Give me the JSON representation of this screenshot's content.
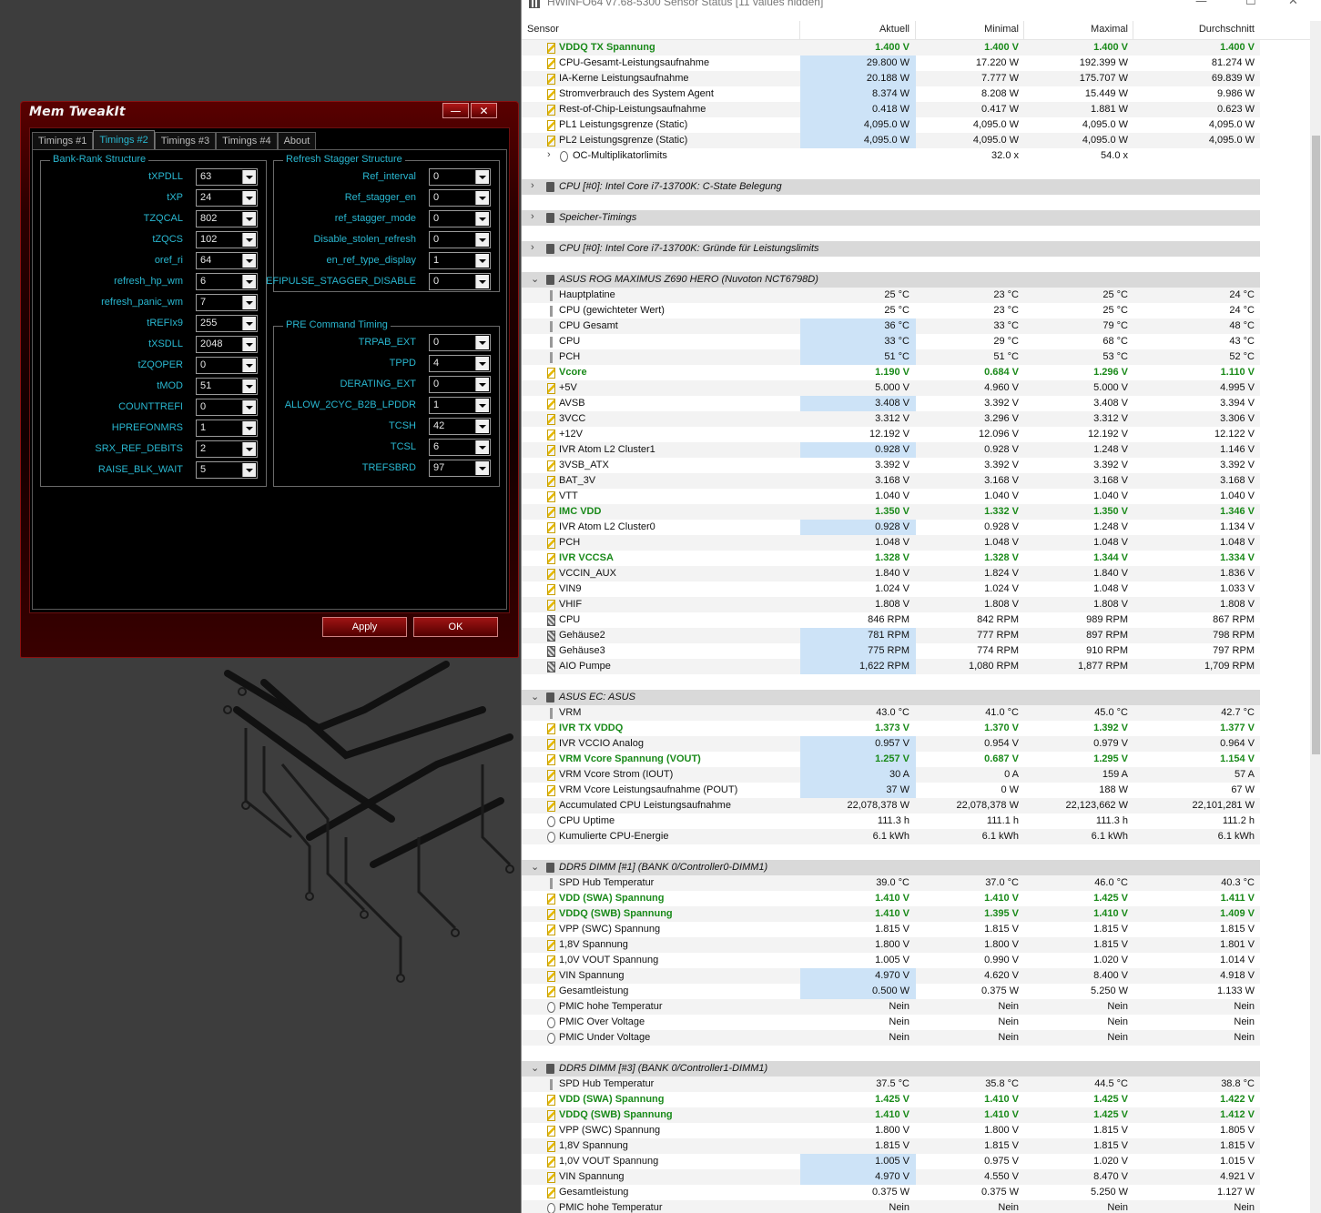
{
  "memtweakit": {
    "title": "Mem TweakIt",
    "min_glyph": "—",
    "close_glyph": "✕",
    "tabs": [
      "Timings #1",
      "Timings #2",
      "Timings #3",
      "Timings #4",
      "About"
    ],
    "active_tab": "Timings #2",
    "bank_rank": {
      "title": "Bank-Rank Structure",
      "rows": [
        {
          "label": "tXPDLL",
          "value": "63"
        },
        {
          "label": "tXP",
          "value": "24"
        },
        {
          "label": "TZQCAL",
          "value": "802"
        },
        {
          "label": "tZQCS",
          "value": "102"
        },
        {
          "label": "oref_ri",
          "value": "64"
        },
        {
          "label": "refresh_hp_wm",
          "value": "6"
        },
        {
          "label": "refresh_panic_wm",
          "value": "7"
        },
        {
          "label": "tREFIx9",
          "value": "255"
        },
        {
          "label": "tXSDLL",
          "value": "2048"
        },
        {
          "label": "tZQOPER",
          "value": "0"
        },
        {
          "label": "tMOD",
          "value": "51"
        },
        {
          "label": "COUNTTREFI",
          "value": "0"
        },
        {
          "label": "HPREFONMRS",
          "value": "1"
        },
        {
          "label": "SRX_REF_DEBITS",
          "value": "2"
        },
        {
          "label": "RAISE_BLK_WAIT",
          "value": "5"
        }
      ]
    },
    "refresh_stagger": {
      "title": "Refresh Stagger Structure",
      "rows": [
        {
          "label": "Ref_interval",
          "value": "0"
        },
        {
          "label": "Ref_stagger_en",
          "value": "0"
        },
        {
          "label": "ref_stagger_mode",
          "value": "0"
        },
        {
          "label": "Disable_stolen_refresh",
          "value": "0"
        },
        {
          "label": "en_ref_type_display",
          "value": "1"
        },
        {
          "label": "EFIPULSE_STAGGER_DISABLE",
          "value": "0"
        }
      ]
    },
    "pre_command": {
      "title": "PRE Command Timing",
      "rows": [
        {
          "label": "TRPAB_EXT",
          "value": "0"
        },
        {
          "label": "TPPD",
          "value": "4"
        },
        {
          "label": "DERATING_EXT",
          "value": "0"
        },
        {
          "label": "ALLOW_2CYC_B2B_LPDDR",
          "value": "1"
        },
        {
          "label": "TCSH",
          "value": "42"
        },
        {
          "label": "TCSL",
          "value": "6"
        },
        {
          "label": "TREFSBRD",
          "value": "97"
        }
      ]
    },
    "apply_label": "Apply",
    "ok_label": "OK"
  },
  "hwinfo": {
    "title": "HWiNFO64 v7.68-5300 Sensor Status [11 values hidden]",
    "controls": {
      "min": "—",
      "max": "☐",
      "close": "✕"
    },
    "columns": [
      "Sensor",
      "Aktuell",
      "Minimal",
      "Maximal",
      "Durchschnitt"
    ],
    "colors": {
      "green": "#1a8a1a",
      "highlight": "#cde3f7",
      "section_bg": "#d9d9d9"
    },
    "rows": [
      {
        "t": "v",
        "icon": "volt",
        "name": "VDDQ TX Spannung",
        "green": true,
        "cur": "1.400 V",
        "min": "1.400 V",
        "max": "1.400 V",
        "avg": "1.400 V"
      },
      {
        "t": "v",
        "icon": "volt",
        "name": "CPU-Gesamt-Leistungsaufnahme",
        "hl": true,
        "cur": "29.800 W",
        "min": "17.220 W",
        "max": "192.399 W",
        "avg": "81.274 W"
      },
      {
        "t": "v",
        "icon": "volt",
        "name": "IA-Kerne Leistungsaufnahme",
        "hl": true,
        "cur": "20.188 W",
        "min": "7.777 W",
        "max": "175.707 W",
        "avg": "69.839 W"
      },
      {
        "t": "v",
        "icon": "volt",
        "name": "Stromverbrauch des System Agent",
        "hl": true,
        "cur": "8.374 W",
        "min": "8.208 W",
        "max": "15.449 W",
        "avg": "9.986 W"
      },
      {
        "t": "v",
        "icon": "volt",
        "name": "Rest-of-Chip-Leistungsaufnahme",
        "hl": true,
        "cur": "0.418 W",
        "min": "0.417 W",
        "max": "1.881 W",
        "avg": "0.623 W"
      },
      {
        "t": "v",
        "icon": "volt",
        "name": "PL1 Leistungsgrenze (Static)",
        "hl": true,
        "cur": "4,095.0 W",
        "min": "4,095.0 W",
        "max": "4,095.0 W",
        "avg": "4,095.0 W"
      },
      {
        "t": "v",
        "icon": "volt",
        "name": "PL2 Leistungsgrenze (Static)",
        "hl": true,
        "cur": "4,095.0 W",
        "min": "4,095.0 W",
        "max": "4,095.0 W",
        "avg": "4,095.0 W"
      },
      {
        "t": "g",
        "icon": "clk",
        "name": "OC-Multiplikatorlimits",
        "cur": "",
        "min": "32.0 x",
        "max": "54.0 x",
        "avg": ""
      },
      {
        "t": "blank"
      },
      {
        "t": "s",
        "exp": ">",
        "name": "CPU [#0]: Intel Core i7-13700K: C-State Belegung"
      },
      {
        "t": "blank"
      },
      {
        "t": "s",
        "exp": ">",
        "name": "Speicher-Timings"
      },
      {
        "t": "blank"
      },
      {
        "t": "s",
        "exp": ">",
        "name": "CPU [#0]: Intel Core i7-13700K: Gründe für Leistungslimits"
      },
      {
        "t": "blank"
      },
      {
        "t": "s",
        "exp": "v",
        "name": "ASUS ROG MAXIMUS Z690 HERO (Nuvoton NCT6798D)"
      },
      {
        "t": "v",
        "icon": "temp",
        "name": "Hauptplatine",
        "cur": "25 °C",
        "min": "23 °C",
        "max": "25 °C",
        "avg": "24 °C"
      },
      {
        "t": "v",
        "icon": "temp",
        "name": "CPU (gewichteter Wert)",
        "cur": "25 °C",
        "min": "23 °C",
        "max": "25 °C",
        "avg": "24 °C"
      },
      {
        "t": "v",
        "icon": "temp",
        "name": "CPU Gesamt",
        "hl": true,
        "cur": "36 °C",
        "min": "33 °C",
        "max": "79 °C",
        "avg": "48 °C"
      },
      {
        "t": "v",
        "icon": "temp",
        "name": "CPU",
        "hl": true,
        "cur": "33 °C",
        "min": "29 °C",
        "max": "68 °C",
        "avg": "43 °C"
      },
      {
        "t": "v",
        "icon": "temp",
        "name": "PCH",
        "hl": true,
        "cur": "51 °C",
        "min": "51 °C",
        "max": "53 °C",
        "avg": "52 °C"
      },
      {
        "t": "v",
        "icon": "volt",
        "name": "Vcore",
        "green": true,
        "cur": "1.190 V",
        "min": "0.684 V",
        "max": "1.296 V",
        "avg": "1.110 V"
      },
      {
        "t": "v",
        "icon": "volt",
        "name": "+5V",
        "cur": "5.000 V",
        "min": "4.960 V",
        "max": "5.000 V",
        "avg": "4.995 V"
      },
      {
        "t": "v",
        "icon": "volt",
        "name": "AVSB",
        "hl": true,
        "cur": "3.408 V",
        "min": "3.392 V",
        "max": "3.408 V",
        "avg": "3.394 V"
      },
      {
        "t": "v",
        "icon": "volt",
        "name": "3VCC",
        "cur": "3.312 V",
        "min": "3.296 V",
        "max": "3.312 V",
        "avg": "3.306 V"
      },
      {
        "t": "v",
        "icon": "volt",
        "name": "+12V",
        "cur": "12.192 V",
        "min": "12.096 V",
        "max": "12.192 V",
        "avg": "12.122 V"
      },
      {
        "t": "v",
        "icon": "volt",
        "name": "IVR Atom L2 Cluster1",
        "hl": true,
        "cur": "0.928 V",
        "min": "0.928 V",
        "max": "1.248 V",
        "avg": "1.146 V"
      },
      {
        "t": "v",
        "icon": "volt",
        "name": "3VSB_ATX",
        "cur": "3.392 V",
        "min": "3.392 V",
        "max": "3.392 V",
        "avg": "3.392 V"
      },
      {
        "t": "v",
        "icon": "volt",
        "name": "BAT_3V",
        "cur": "3.168 V",
        "min": "3.168 V",
        "max": "3.168 V",
        "avg": "3.168 V"
      },
      {
        "t": "v",
        "icon": "volt",
        "name": "VTT",
        "cur": "1.040 V",
        "min": "1.040 V",
        "max": "1.040 V",
        "avg": "1.040 V"
      },
      {
        "t": "v",
        "icon": "volt",
        "name": "IMC VDD",
        "green": true,
        "cur": "1.350 V",
        "min": "1.332 V",
        "max": "1.350 V",
        "avg": "1.346 V"
      },
      {
        "t": "v",
        "icon": "volt",
        "name": "IVR Atom L2 Cluster0",
        "hl": true,
        "cur": "0.928 V",
        "min": "0.928 V",
        "max": "1.248 V",
        "avg": "1.134 V"
      },
      {
        "t": "v",
        "icon": "volt",
        "name": "PCH",
        "cur": "1.048 V",
        "min": "1.048 V",
        "max": "1.048 V",
        "avg": "1.048 V"
      },
      {
        "t": "v",
        "icon": "volt",
        "name": "IVR VCCSA",
        "green": true,
        "cur": "1.328 V",
        "min": "1.328 V",
        "max": "1.344 V",
        "avg": "1.334 V"
      },
      {
        "t": "v",
        "icon": "volt",
        "name": "VCCIN_AUX",
        "cur": "1.840 V",
        "min": "1.824 V",
        "max": "1.840 V",
        "avg": "1.836 V"
      },
      {
        "t": "v",
        "icon": "volt",
        "name": "VIN9",
        "cur": "1.024 V",
        "min": "1.024 V",
        "max": "1.048 V",
        "avg": "1.033 V"
      },
      {
        "t": "v",
        "icon": "volt",
        "name": "VHIF",
        "cur": "1.808 V",
        "min": "1.808 V",
        "max": "1.808 V",
        "avg": "1.808 V"
      },
      {
        "t": "v",
        "icon": "fan",
        "name": "CPU",
        "cur": "846 RPM",
        "min": "842 RPM",
        "max": "989 RPM",
        "avg": "867 RPM"
      },
      {
        "t": "v",
        "icon": "fan",
        "name": "Gehäuse2",
        "hl": true,
        "cur": "781 RPM",
        "min": "777 RPM",
        "max": "897 RPM",
        "avg": "798 RPM"
      },
      {
        "t": "v",
        "icon": "fan",
        "name": "Gehäuse3",
        "hl": true,
        "cur": "775 RPM",
        "min": "774 RPM",
        "max": "910 RPM",
        "avg": "797 RPM"
      },
      {
        "t": "v",
        "icon": "fan",
        "name": "AIO Pumpe",
        "hl": true,
        "cur": "1,622 RPM",
        "min": "1,080 RPM",
        "max": "1,877 RPM",
        "avg": "1,709 RPM"
      },
      {
        "t": "blank"
      },
      {
        "t": "s",
        "exp": "v",
        "name": "ASUS EC: ASUS"
      },
      {
        "t": "v",
        "icon": "temp",
        "name": "VRM",
        "cur": "43.0 °C",
        "min": "41.0 °C",
        "max": "45.0 °C",
        "avg": "42.7 °C"
      },
      {
        "t": "v",
        "icon": "volt",
        "name": "IVR TX VDDQ",
        "green": true,
        "cur": "1.373 V",
        "min": "1.370 V",
        "max": "1.392 V",
        "avg": "1.377 V"
      },
      {
        "t": "v",
        "icon": "volt",
        "name": "IVR VCCIO Analog",
        "hl": true,
        "cur": "0.957 V",
        "min": "0.954 V",
        "max": "0.979 V",
        "avg": "0.964 V"
      },
      {
        "t": "v",
        "icon": "volt",
        "name": "VRM Vcore Spannung (VOUT)",
        "green": true,
        "hl": true,
        "cur": "1.257 V",
        "min": "0.687 V",
        "max": "1.295 V",
        "avg": "1.154 V"
      },
      {
        "t": "v",
        "icon": "volt",
        "name": "VRM Vcore Strom (IOUT)",
        "hl": true,
        "cur": "30 A",
        "min": "0 A",
        "max": "159 A",
        "avg": "57 A"
      },
      {
        "t": "v",
        "icon": "volt",
        "name": "VRM Vcore Leistungsaufnahme (POUT)",
        "hl": true,
        "cur": "37 W",
        "min": "0 W",
        "max": "188 W",
        "avg": "67 W"
      },
      {
        "t": "v",
        "icon": "volt",
        "name": "Accumulated CPU Leistungsaufnahme",
        "cur": "22,078,378 W",
        "min": "22,078,378 W",
        "max": "22,123,662 W",
        "avg": "22,101,281 W"
      },
      {
        "t": "v",
        "icon": "clk",
        "name": "CPU Uptime",
        "cur": "111.3 h",
        "min": "111.1 h",
        "max": "111.3 h",
        "avg": "111.2 h"
      },
      {
        "t": "v",
        "icon": "clk",
        "name": "Kumulierte CPU-Energie",
        "cur": "6.1 kWh",
        "min": "6.1 kWh",
        "max": "6.1 kWh",
        "avg": "6.1 kWh"
      },
      {
        "t": "blank"
      },
      {
        "t": "s",
        "exp": "v",
        "name": "DDR5 DIMM [#1] (BANK 0/Controller0-DIMM1)"
      },
      {
        "t": "v",
        "icon": "temp",
        "name": "SPD Hub Temperatur",
        "cur": "39.0 °C",
        "min": "37.0 °C",
        "max": "46.0 °C",
        "avg": "40.3 °C"
      },
      {
        "t": "v",
        "icon": "volt",
        "name": "VDD (SWA) Spannung",
        "green": true,
        "cur": "1.410 V",
        "min": "1.410 V",
        "max": "1.425 V",
        "avg": "1.411 V"
      },
      {
        "t": "v",
        "icon": "volt",
        "name": "VDDQ (SWB) Spannung",
        "green": true,
        "cur": "1.410 V",
        "min": "1.395 V",
        "max": "1.410 V",
        "avg": "1.409 V"
      },
      {
        "t": "v",
        "icon": "volt",
        "name": "VPP (SWC) Spannung",
        "cur": "1.815 V",
        "min": "1.815 V",
        "max": "1.815 V",
        "avg": "1.815 V"
      },
      {
        "t": "v",
        "icon": "volt",
        "name": "1,8V Spannung",
        "cur": "1.800 V",
        "min": "1.800 V",
        "max": "1.815 V",
        "avg": "1.801 V"
      },
      {
        "t": "v",
        "icon": "volt",
        "name": "1,0V VOUT Spannung",
        "cur": "1.005 V",
        "min": "0.990 V",
        "max": "1.020 V",
        "avg": "1.014 V"
      },
      {
        "t": "v",
        "icon": "volt",
        "name": "VIN Spannung",
        "hl": true,
        "cur": "4.970 V",
        "min": "4.620 V",
        "max": "8.400 V",
        "avg": "4.918 V"
      },
      {
        "t": "v",
        "icon": "volt",
        "name": "Gesamtleistung",
        "hl": true,
        "cur": "0.500 W",
        "min": "0.375 W",
        "max": "5.250 W",
        "avg": "1.133 W"
      },
      {
        "t": "v",
        "icon": "clk",
        "name": "PMIC hohe Temperatur",
        "cur": "Nein",
        "min": "Nein",
        "max": "Nein",
        "avg": "Nein"
      },
      {
        "t": "v",
        "icon": "clk",
        "name": "PMIC Over Voltage",
        "cur": "Nein",
        "min": "Nein",
        "max": "Nein",
        "avg": "Nein"
      },
      {
        "t": "v",
        "icon": "clk",
        "name": "PMIC Under Voltage",
        "cur": "Nein",
        "min": "Nein",
        "max": "Nein",
        "avg": "Nein"
      },
      {
        "t": "blank"
      },
      {
        "t": "s",
        "exp": "v",
        "name": "DDR5 DIMM [#3] (BANK 0/Controller1-DIMM1)"
      },
      {
        "t": "v",
        "icon": "temp",
        "name": "SPD Hub Temperatur",
        "cur": "37.5 °C",
        "min": "35.8 °C",
        "max": "44.5 °C",
        "avg": "38.8 °C"
      },
      {
        "t": "v",
        "icon": "volt",
        "name": "VDD (SWA) Spannung",
        "green": true,
        "cur": "1.425 V",
        "min": "1.410 V",
        "max": "1.425 V",
        "avg": "1.422 V"
      },
      {
        "t": "v",
        "icon": "volt",
        "name": "VDDQ (SWB) Spannung",
        "green": true,
        "cur": "1.410 V",
        "min": "1.410 V",
        "max": "1.425 V",
        "avg": "1.412 V"
      },
      {
        "t": "v",
        "icon": "volt",
        "name": "VPP (SWC) Spannung",
        "cur": "1.800 V",
        "min": "1.800 V",
        "max": "1.815 V",
        "avg": "1.805 V"
      },
      {
        "t": "v",
        "icon": "volt",
        "name": "1,8V Spannung",
        "cur": "1.815 V",
        "min": "1.815 V",
        "max": "1.815 V",
        "avg": "1.815 V"
      },
      {
        "t": "v",
        "icon": "volt",
        "name": "1,0V VOUT Spannung",
        "hl": true,
        "cur": "1.005 V",
        "min": "0.975 V",
        "max": "1.020 V",
        "avg": "1.015 V"
      },
      {
        "t": "v",
        "icon": "volt",
        "name": "VIN Spannung",
        "hl": true,
        "cur": "4.970 V",
        "min": "4.550 V",
        "max": "8.470 V",
        "avg": "4.921 V"
      },
      {
        "t": "v",
        "icon": "volt",
        "name": "Gesamtleistung",
        "cur": "0.375 W",
        "min": "0.375 W",
        "max": "5.250 W",
        "avg": "1.127 W"
      },
      {
        "t": "v",
        "icon": "clk",
        "name": "PMIC hohe Temperatur",
        "cur": "Nein",
        "min": "Nein",
        "max": "Nein",
        "avg": "Nein"
      }
    ]
  }
}
